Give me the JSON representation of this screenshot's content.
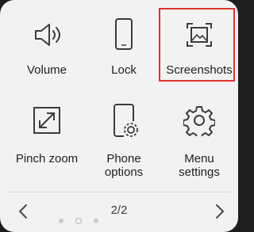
{
  "tiles": [
    {
      "label": "Volume",
      "icon": "volume-icon"
    },
    {
      "label": "Lock",
      "icon": "phone-lock-icon"
    },
    {
      "label": "Screenshots",
      "icon": "screenshot-icon"
    },
    {
      "label": "Pinch zoom",
      "icon": "pinch-zoom-icon"
    },
    {
      "label_line1": "Phone",
      "label_line2": "options",
      "icon": "phone-settings-icon"
    },
    {
      "label_line1": "Menu",
      "label_line2": "settings",
      "icon": "gear-icon"
    }
  ],
  "pager": {
    "text": "2/2",
    "total_pages": 2,
    "current_page": 2
  },
  "colors": {
    "panel": "#f2f2f2",
    "highlight": "#e03030",
    "icon": "#3c3c3c"
  }
}
